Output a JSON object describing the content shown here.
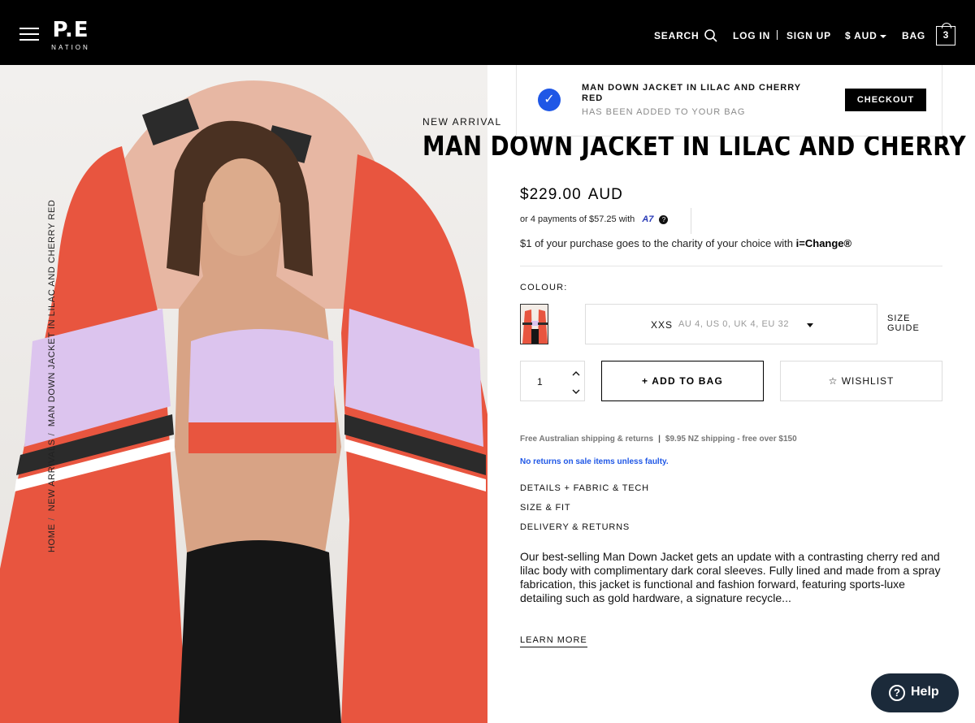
{
  "header": {
    "logo_mark": "P.E",
    "logo_sub": "NATION",
    "search_label": "SEARCH",
    "login_label": "LOG IN",
    "signup_label": "SIGN UP",
    "currency_label": "$ AUD",
    "bag_label": "BAG",
    "bag_count": "3"
  },
  "breadcrumb": [
    "HOME",
    "NEW ARRIVALS",
    "MAN DOWN JACKET IN LILAC AND CHERRY RED"
  ],
  "toast": {
    "title": "MAN DOWN JACKET IN LILAC AND CHERRY RED",
    "subtitle": "HAS BEEN ADDED TO YOUR BAG",
    "checkout_label": "CHECKOUT"
  },
  "product": {
    "badge": "NEW ARRIVAL",
    "title": "MAN DOWN JACKET IN LILAC AND CHERRY RED",
    "price": "$229.00",
    "currency": "AUD",
    "afterpay_text": "or 4 payments of $57.25 with",
    "charity_text": "$1 of your purchase goes to the charity of your choice with",
    "charity_brand": "i=Change®",
    "colour_label": "COLOUR:",
    "size_value": "XXS",
    "size_detail": "AU 4, US 0, UK 4, EU 32",
    "size_guide_label": "SIZE GUIDE",
    "quantity": "1",
    "add_label": "+ ADD TO BAG",
    "wishlist_label": "WISHLIST",
    "shipping_au": "Free Australian shipping & returns",
    "shipping_nz": "$9.95 NZ shipping - free over $150",
    "no_returns": "No returns on sale items unless faulty.",
    "accordion": [
      "DETAILS + FABRIC & TECH",
      "SIZE & FIT",
      "DELIVERY & RETURNS"
    ],
    "description": "Our best-selling Man Down Jacket gets an update with a contrasting cherry red and lilac body with complimentary dark coral sleeves. Fully lined and made from a spray fabrication, this jacket is functional and fashion forward, featuring sports-luxe detailing such as gold hardware, a signature recycle...",
    "learn_more": "LEARN MORE"
  },
  "help": {
    "label": "Help"
  },
  "colors": {
    "accent_blue": "#1f57e6",
    "jacket_red": "#e8553f",
    "lilac": "#dcc4ee"
  },
  "icons": [
    "menu-icon",
    "search-icon",
    "caret-down-icon",
    "bag-icon",
    "check-icon",
    "help-icon",
    "star-icon",
    "chevron-up-icon",
    "chevron-down-icon"
  ]
}
